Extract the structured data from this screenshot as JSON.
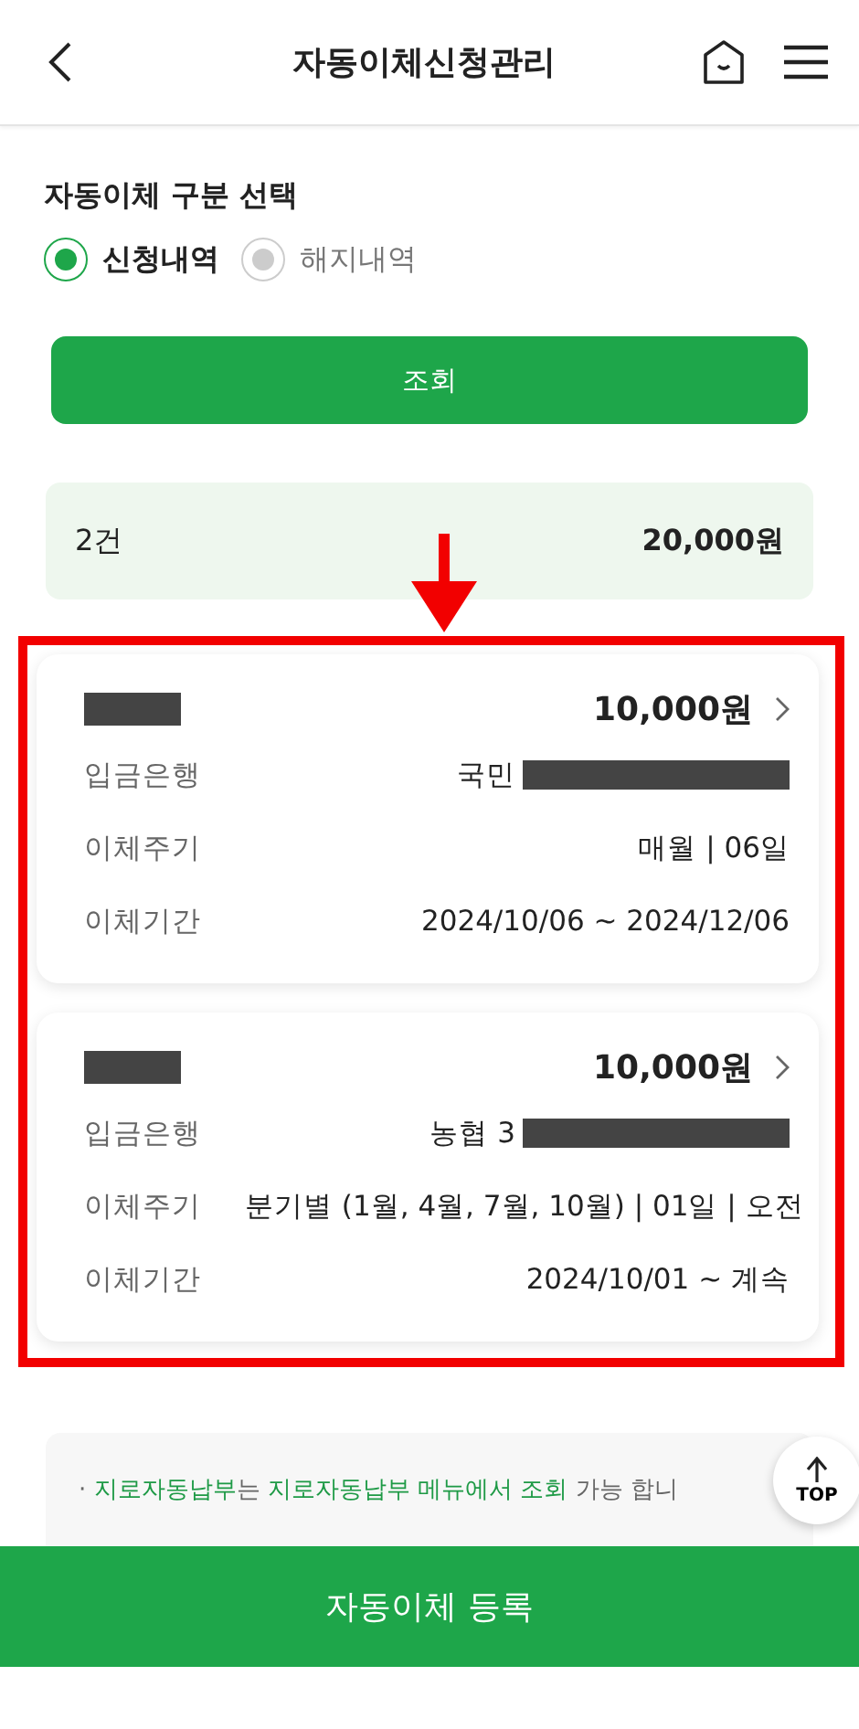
{
  "header": {
    "title": "자동이체신청관리"
  },
  "filter": {
    "title": "자동이체 구분 선택",
    "options": [
      {
        "label": "신청내역",
        "selected": true
      },
      {
        "label": "해지내역",
        "selected": false
      }
    ],
    "button": "조회"
  },
  "summary": {
    "count": "2건",
    "total": "20,000원"
  },
  "transfers": [
    {
      "name_redacted": true,
      "amount": "10,000원",
      "rows": [
        {
          "label": "입금은행",
          "value": "국민",
          "redacted": true
        },
        {
          "label": "이체주기",
          "value": "매월 | 06일",
          "redacted": false
        },
        {
          "label": "이체기간",
          "value": "2024/10/06 ~ 2024/12/06",
          "redacted": false
        }
      ]
    },
    {
      "name_redacted": true,
      "amount": "10,000원",
      "rows": [
        {
          "label": "입금은행",
          "value": "농협 3",
          "redacted": true
        },
        {
          "label": "이체주기",
          "value": "분기별 (1월, 4월, 7월, 10월) | 01일 | 오전",
          "redacted": false
        },
        {
          "label": "이체기간",
          "value": "2024/10/01 ~ 계속",
          "redacted": false
        }
      ]
    }
  ],
  "notice": {
    "bullet": "·",
    "segments": [
      {
        "text": "지로자동납부",
        "highlight": true
      },
      {
        "text": "는 ",
        "highlight": false
      },
      {
        "text": "지로자동납부 메뉴에서 조회",
        "highlight": true
      },
      {
        "text": " 가능 합니",
        "highlight": false
      }
    ]
  },
  "top_button": "TOP",
  "register_button": "자동이체 등록"
}
